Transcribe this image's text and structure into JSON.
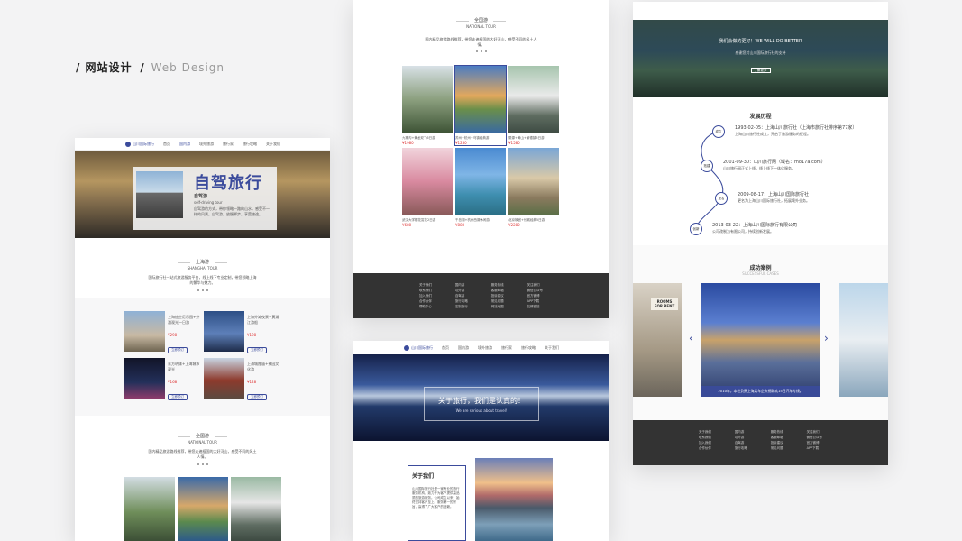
{
  "brand": {
    "prefix": "/ 网站设计",
    "slash": "/",
    "suffix": "Web Design"
  },
  "colors": {
    "accent": "#3b4b9c",
    "dark": "#333333",
    "price": "#dd3333"
  },
  "left_page": {
    "logo": "山川国际旅行",
    "nav": [
      "首页",
      "国内游",
      "境外旅游",
      "旅行家",
      "旅行攻略",
      "关于我们"
    ],
    "hero_title": "自驾旅行",
    "hero_sub": "自驾游",
    "hero_sub_en": "self-driving tour",
    "hero_desc": "自驾游的方式，带你领略一路的山水，感受不一样的风景。自驾游，放慢脚步，享受旅途。",
    "section1_title": "上海游",
    "section1_en": "SHANGHAI TOUR",
    "section1_desc": "国际旅行社一站式旅游服务平台，线上线下专业定制，带您领略上海的繁华与魅力。",
    "items": [
      {
        "title": "上海迪士尼乐园+外滩观光一日游",
        "price": "¥298",
        "btn": "立即预订"
      },
      {
        "title": "上海外滩夜景+黄浦江游船",
        "price": "¥198",
        "btn": "立即预订"
      },
      {
        "title": "东方明珠+上海城市观光",
        "price": "¥168",
        "btn": "立即预订"
      },
      {
        "title": "上海城隍庙+豫园文化游",
        "price": "¥128",
        "btn": "立即预订"
      }
    ],
    "section2_title": "全国游",
    "section2_en": "NATIONAL TOUR",
    "section2_desc": "国内精品旅游路线推荐，带您走遍祖国的大好河山，感受不同的风土人情。"
  },
  "middle_top": {
    "title": "全国游",
    "en": "NATIONAL TOUR",
    "desc": "国内精品旅游路线推荐，带您走遍祖国的大好河山，感受不同的风土人情。",
    "cards": [
      {
        "title": "九寨沟+黄龙双飞6日游",
        "price": "¥1980"
      },
      {
        "title": "苏州+杭州+乌镇经典游",
        "price": "¥1280"
      },
      {
        "title": "婺源+黄山+景德镇5日游",
        "price": "¥1580"
      },
      {
        "title": "武汉大学樱花赏花2日游",
        "price": "¥680"
      },
      {
        "title": "千岛湖+杭州西湖休闲游",
        "price": "¥880"
      },
      {
        "title": "北京故宫+长城经典5日游",
        "price": "¥2280"
      }
    ],
    "footer": [
      [
        "关于我们",
        "联系我们",
        "加入我们",
        "合作伙伴",
        "帮助中心"
      ],
      [
        "国内游",
        "境外游",
        "自驾游",
        "旅行攻略",
        "定制旅行"
      ],
      [
        "服务热线",
        "客服邮箱",
        "投诉建议",
        "常见问题",
        "网站地图"
      ],
      [
        "关注我们",
        "微信公众号",
        "官方微博",
        "APP下载",
        "友情链接"
      ]
    ]
  },
  "middle_bottom": {
    "logo": "山川国际旅行",
    "nav": [
      "首页",
      "国内游",
      "境外旅游",
      "旅行家",
      "旅行攻略",
      "关于我们"
    ],
    "hero_title": "关于旅行，我们是认真的！",
    "hero_en": "We are serious about travel!",
    "about_title": "关于我们",
    "about_text": "山川国际旅行社是一家专业的旅行服务机构，致力于为客户提供高品质的旅游服务。公司成立以来，始终坚持客户至上、服务第一的宗旨，赢得了广大客户的信赖。"
  },
  "right_page": {
    "hero_line": "我们会做的更好！WE WILL DO BETTER",
    "hero_sub": "感谢您对山川国际旅行社的支持",
    "hero_btn": "了解更多",
    "history_title": "发展历程",
    "history": [
      {
        "node": "成立",
        "date": "1993-02-05：上海山川旅行社（上海市旅行社排序第77家）",
        "desc": "上海山川旅行社成立，开启了旅游服务的征程。"
      },
      {
        "node": "拓建",
        "date": "2001-09-30：山川旅行网（域名：mo17a.com）",
        "desc": "山川旅行网正式上线，线上线下一体化服务。"
      },
      {
        "node": "更名",
        "date": "2009-08-17：上海山川国际旅行社",
        "desc": "更名为上海山川国际旅行社，拓展境外业务。"
      },
      {
        "node": "创新",
        "date": "2013-03-22：上海山川国际旅行有限公司",
        "desc": "公司改制为有限公司，持续创新发展。"
      }
    ],
    "cases_title": "成功案例",
    "cases_en": "SUCCESSFUL CASES",
    "case_caption": "2010年，本社负责上海某车企庆祝联欢15日汽车专线。",
    "side_sign": "ROOMS FOR RENT",
    "footer": [
      [
        "关于我们",
        "联系我们",
        "加入我们",
        "合作伙伴"
      ],
      [
        "国内游",
        "境外游",
        "自驾游",
        "旅行攻略"
      ],
      [
        "服务热线",
        "客服邮箱",
        "投诉建议",
        "常见问题"
      ],
      [
        "关注我们",
        "微信公众号",
        "官方微博",
        "APP下载"
      ]
    ]
  }
}
